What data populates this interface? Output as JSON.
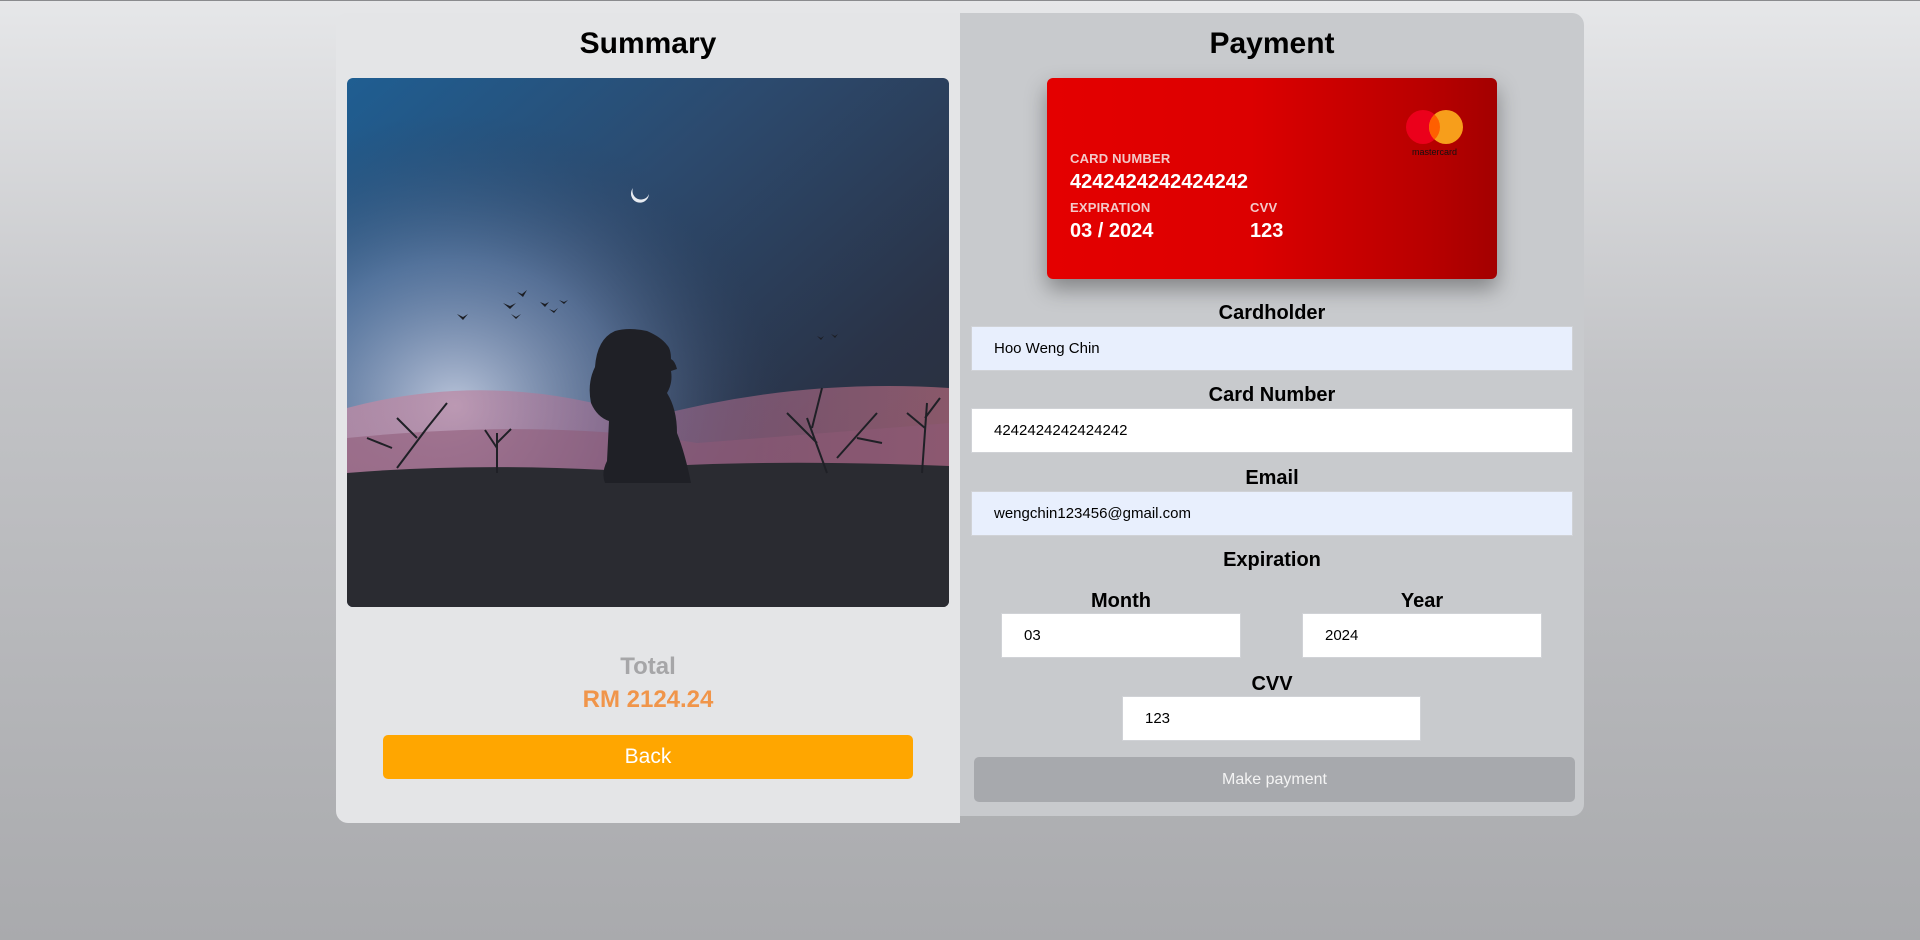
{
  "summary": {
    "title": "Summary",
    "image_description_name": "night-sky-silhouette-photo",
    "total_label": "Total",
    "total_value": "RM 2124.24",
    "back_label": "Back"
  },
  "payment": {
    "title": "Payment",
    "card": {
      "brand": "mastercard",
      "number_label": "CARD NUMBER",
      "number": "4242424242424242",
      "expiration_label": "EXPIRATION",
      "expiration": "03 / 2024",
      "cvv_label": "CVV",
      "cvv": "123"
    },
    "fields": {
      "cardholder_label": "Cardholder",
      "cardholder_value": "Hoo Weng Chin",
      "card_number_label": "Card Number",
      "card_number_value": "4242424242424242",
      "email_label": "Email",
      "email_value": "wengchin123456@gmail.com",
      "expiration_label": "Expiration",
      "month_label": "Month",
      "month_value": "03",
      "year_label": "Year",
      "year_value": "2024",
      "cvv_label": "CVV",
      "cvv_value": "123"
    },
    "make_payment_label": "Make payment"
  },
  "colors": {
    "back_button": "#ffa600",
    "total_value": "#f0954a",
    "card_red": "#e40000",
    "make_payment_button": "#a7a9ad",
    "autofill_field": "#e8effd"
  }
}
